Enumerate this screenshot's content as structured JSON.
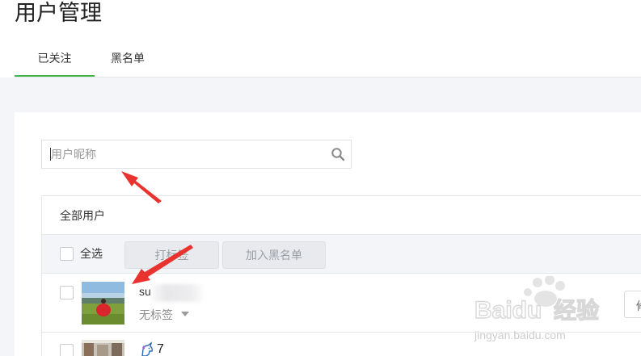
{
  "page": {
    "title": "用户管理"
  },
  "tabs": [
    {
      "label": "已关注",
      "active": true
    },
    {
      "label": "黑名单",
      "active": false
    }
  ],
  "search": {
    "placeholder": "用户昵称",
    "value": ""
  },
  "table": {
    "group_label": "全部用户",
    "select_all_label": "全选",
    "tag_button_label": "打标签",
    "blacklist_button_label": "加入黑名单",
    "rows": [
      {
        "nickname": "su",
        "tag": "无标签",
        "action_label": "修"
      },
      {
        "nickname": "7"
      }
    ]
  },
  "watermark": {
    "brand": "Baidu",
    "product": "经验",
    "url": "jingyan.baidu.com"
  },
  "colors": {
    "accent": "#44b549",
    "annotation_arrow": "#e8332f"
  }
}
